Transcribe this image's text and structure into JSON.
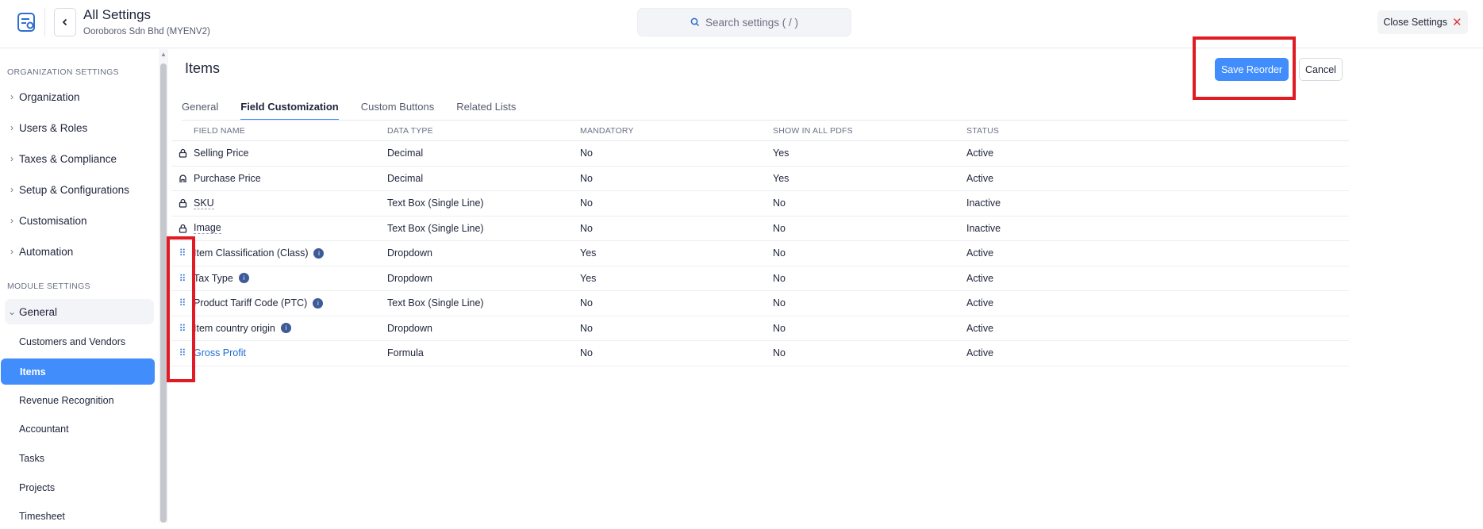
{
  "header": {
    "title": "All Settings",
    "org": "Ooroboros Sdn Bhd (MYENV2)",
    "search_placeholder": "Search settings ( / )",
    "close_label": "Close Settings"
  },
  "sidebar": {
    "org_heading": "ORGANIZATION SETTINGS",
    "org_items": [
      "Organization",
      "Users & Roles",
      "Taxes & Compliance",
      "Setup & Configurations",
      "Customisation",
      "Automation"
    ],
    "module_heading": "MODULE SETTINGS",
    "general_label": "General",
    "sub_items": [
      "Customers and Vendors",
      "Items",
      "Revenue Recognition",
      "Accountant",
      "Tasks",
      "Projects",
      "Timesheet"
    ],
    "active_sub": "Items"
  },
  "main": {
    "title": "Items",
    "save_label": "Save Reorder",
    "cancel_label": "Cancel",
    "tabs": [
      "General",
      "Field Customization",
      "Custom Buttons",
      "Related Lists"
    ],
    "active_tab": "Field Customization",
    "columns": [
      "FIELD NAME",
      "DATA TYPE",
      "MANDATORY",
      "SHOW IN ALL PDFS",
      "STATUS"
    ],
    "rows": [
      {
        "name": "Selling Price",
        "type": "Decimal",
        "mandatory": "No",
        "pdf": "Yes",
        "status": "Active",
        "handle": "lock"
      },
      {
        "name": "Purchase Price",
        "type": "Decimal",
        "mandatory": "No",
        "pdf": "Yes",
        "status": "Active",
        "handle": "unlock"
      },
      {
        "name": "SKU",
        "type": "Text Box (Single Line)",
        "mandatory": "No",
        "pdf": "No",
        "status": "Inactive",
        "handle": "lock"
      },
      {
        "name": "Image",
        "type": "Text Box (Single Line)",
        "mandatory": "No",
        "pdf": "No",
        "status": "Inactive",
        "handle": "lock"
      },
      {
        "name": "Item Classification (Class)",
        "type": "Dropdown",
        "mandatory": "Yes",
        "pdf": "No",
        "status": "Active",
        "handle": "drag"
      },
      {
        "name": "Tax Type",
        "type": "Dropdown",
        "mandatory": "Yes",
        "pdf": "No",
        "status": "Active",
        "handle": "drag"
      },
      {
        "name": "Product Tariff Code (PTC)",
        "type": "Text Box (Single Line)",
        "mandatory": "No",
        "pdf": "No",
        "status": "Active",
        "handle": "drag"
      },
      {
        "name": "Item country origin",
        "type": "Dropdown",
        "mandatory": "No",
        "pdf": "No",
        "status": "Active",
        "handle": "drag"
      },
      {
        "name": "Gross Profit",
        "type": "Formula",
        "mandatory": "No",
        "pdf": "No",
        "status": "Active",
        "handle": "drag"
      }
    ]
  },
  "colors": {
    "accent": "#408dfb",
    "highlight": "#e01b24",
    "link": "#1f6bd6"
  }
}
